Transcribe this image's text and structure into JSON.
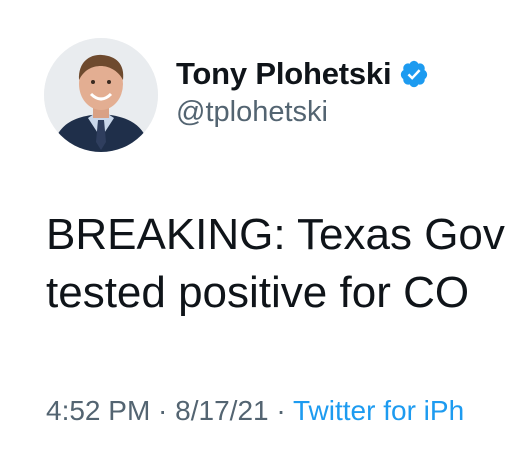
{
  "user": {
    "display_name": "Tony Plohetski",
    "handle": "@tplohetski",
    "verified": true,
    "verified_color": "#1d9bf0"
  },
  "tweet": {
    "line1": "BREAKING: Texas Gov",
    "line2": "tested positive for CO"
  },
  "meta": {
    "time": "4:52 PM",
    "separator": " · ",
    "date": "8/17/21",
    "source": "Twitter for iPh"
  }
}
